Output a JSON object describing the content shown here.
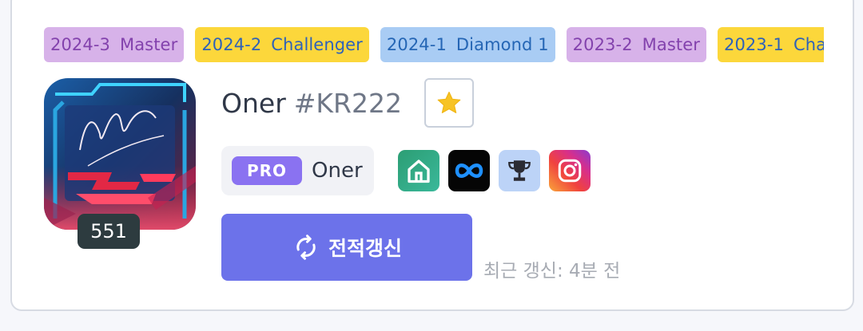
{
  "colors": {
    "accent": "#6c72ea",
    "level_bg": "#2d3b3f",
    "pro_badge": "#8a72f1",
    "master_bg": "#d7b2e9",
    "master_fg": "#8342ad",
    "challenger_bg": "#fcd73b",
    "challenger_fg": "#2f62b8",
    "diamond_bg": "#a9ccf4",
    "diamond_fg": "#2566b5"
  },
  "tier_history": [
    {
      "season": "2024-3",
      "tier": "Master",
      "color_key": "master"
    },
    {
      "season": "2024-2",
      "tier": "Challenger",
      "color_key": "challenger"
    },
    {
      "season": "2024-1",
      "tier": "Diamond 1",
      "color_key": "diamond"
    },
    {
      "season": "2023-2",
      "tier": "Master",
      "color_key": "master"
    },
    {
      "season": "2023-1",
      "tier": "Challenger",
      "color_key": "challenger"
    }
  ],
  "profile": {
    "name": "Oner",
    "tag": "#KR222",
    "level": "551",
    "favorite_icon": "star-icon",
    "pro_badge": "PRO",
    "pro_name": "Oner"
  },
  "social_links": [
    {
      "icon": "home-icon",
      "label": "home"
    },
    {
      "icon": "infinity-icon",
      "label": "infinity"
    },
    {
      "icon": "trophy-icon",
      "label": "trophy"
    },
    {
      "icon": "instagram-icon",
      "label": "instagram"
    }
  ],
  "update": {
    "button_label": "전적갱신",
    "last_updated": "최근 갱신: 4분 전",
    "icon": "refresh-icon"
  }
}
